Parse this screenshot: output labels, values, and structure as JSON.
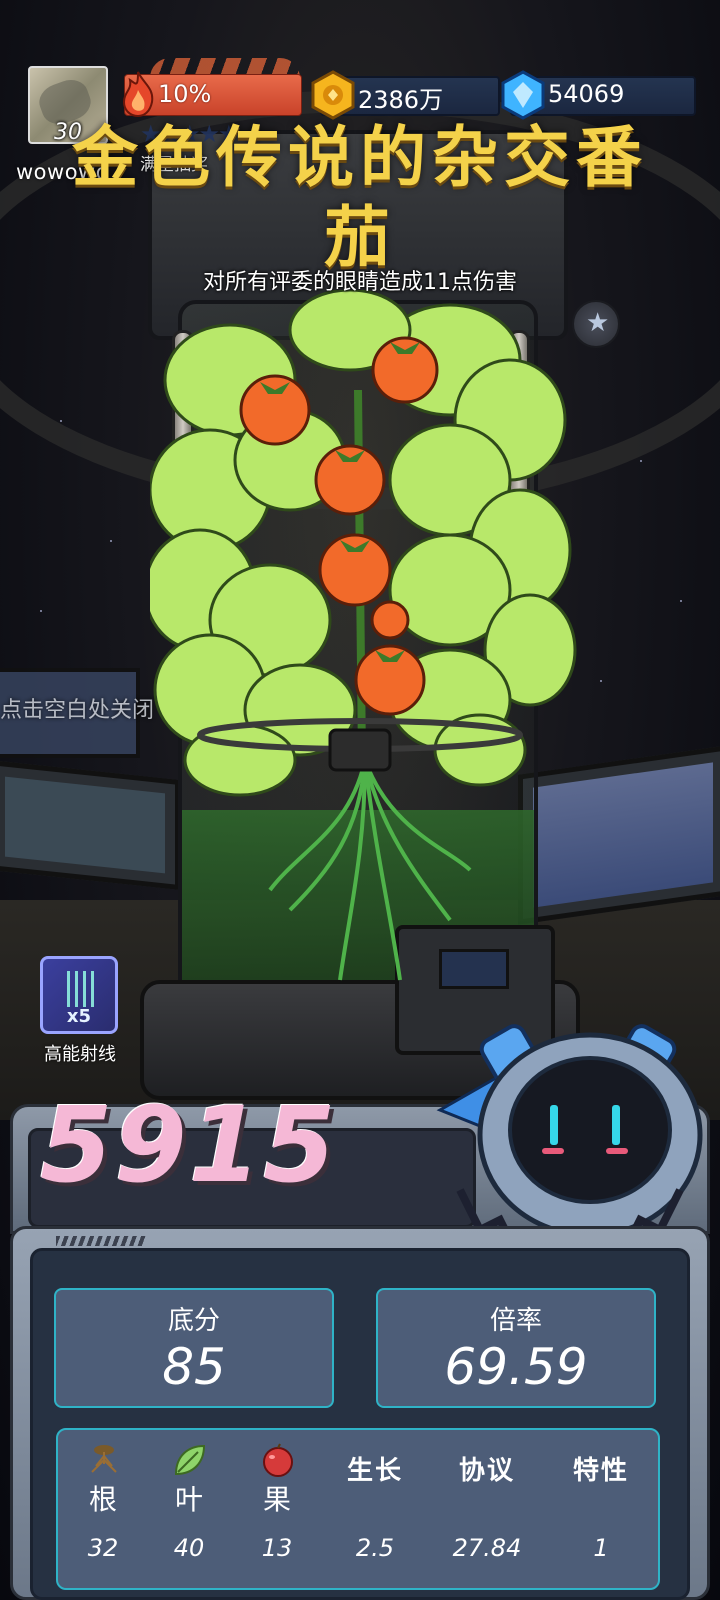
{
  "player": {
    "level": "30",
    "name": "wowowo"
  },
  "hud": {
    "fire_percent": "10%",
    "lottery_label": "满星抽奖",
    "gold": "2386万",
    "gems": "54069"
  },
  "plant": {
    "title": "金色传说的杂交番茄",
    "effect": "对所有评委的眼睛造成11点伤害"
  },
  "close_hint": "点击空白处关闭",
  "skill": {
    "multiplier": "x5",
    "name": "高能射线"
  },
  "score": {
    "total": "5915",
    "base_label": "底分",
    "base_value": "85",
    "mult_label": "倍率",
    "mult_value": "69.59"
  },
  "traits": [
    {
      "icon": "root-icon",
      "label": "根",
      "value": "32"
    },
    {
      "icon": "leaf-icon",
      "label": "叶",
      "value": "40"
    },
    {
      "icon": "fruit-icon",
      "label": "果",
      "value": "13"
    },
    {
      "icon": "",
      "label": "生长",
      "value": "2.5"
    },
    {
      "icon": "",
      "label": "协议",
      "value": "27.84"
    },
    {
      "icon": "",
      "label": "特性",
      "value": "1"
    }
  ],
  "colors": {
    "title_gold": "#f4d24a",
    "score_pink": "#f5b8d6",
    "fire_bar": "#e86b4a",
    "panel_accent": "#2fb3c7"
  }
}
